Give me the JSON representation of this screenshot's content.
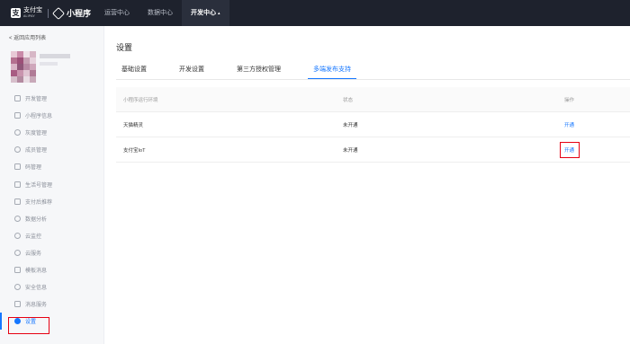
{
  "topbar": {
    "logo_cn": "支付宝",
    "logo_en": "ALIPAY",
    "product": "小程序",
    "nav": [
      {
        "label": "运营中心"
      },
      {
        "label": "数据中心"
      },
      {
        "label": "开发中心",
        "caret": "▴"
      }
    ]
  },
  "sidebar": {
    "back_label": "< 返回应用列表",
    "menu": [
      {
        "label": "开发管理",
        "icon": "code-icon"
      },
      {
        "label": "小程序信息",
        "icon": "info-icon"
      },
      {
        "label": "灰度管理",
        "icon": "gray-release-icon"
      },
      {
        "label": "成员管理",
        "icon": "members-icon"
      },
      {
        "label": "码管理",
        "icon": "qrcode-icon"
      },
      {
        "label": "生活号管理",
        "icon": "life-account-icon"
      },
      {
        "label": "支付后推荐",
        "icon": "recommend-icon"
      },
      {
        "label": "数据分析",
        "icon": "analytics-icon"
      },
      {
        "label": "云监控",
        "icon": "cloud-monitor-icon"
      },
      {
        "label": "云服务",
        "icon": "cloud-service-icon"
      },
      {
        "label": "模板消息",
        "icon": "template-message-icon"
      },
      {
        "label": "安全信息",
        "icon": "shield-icon"
      },
      {
        "label": "消息服务",
        "icon": "message-icon"
      },
      {
        "label": "设置",
        "icon": "gear-icon"
      }
    ],
    "active_index": 13
  },
  "main": {
    "title": "设置",
    "tabs": [
      {
        "label": "基础设置"
      },
      {
        "label": "开发设置"
      },
      {
        "label": "第三方授权管理"
      },
      {
        "label": "多端发布支持"
      }
    ],
    "active_tab": 3,
    "table": {
      "headers": [
        "小程序运行环境",
        "状态",
        "操作"
      ],
      "rows": [
        {
          "env": "天猫精灵",
          "status": "未开通",
          "action": "开通"
        },
        {
          "env": "支付宝IoT",
          "status": "未开通",
          "action": "开通"
        }
      ]
    }
  },
  "colors": {
    "topbar_bg": "#1e222d",
    "accent": "#1677ff",
    "highlight": "#e60012"
  }
}
